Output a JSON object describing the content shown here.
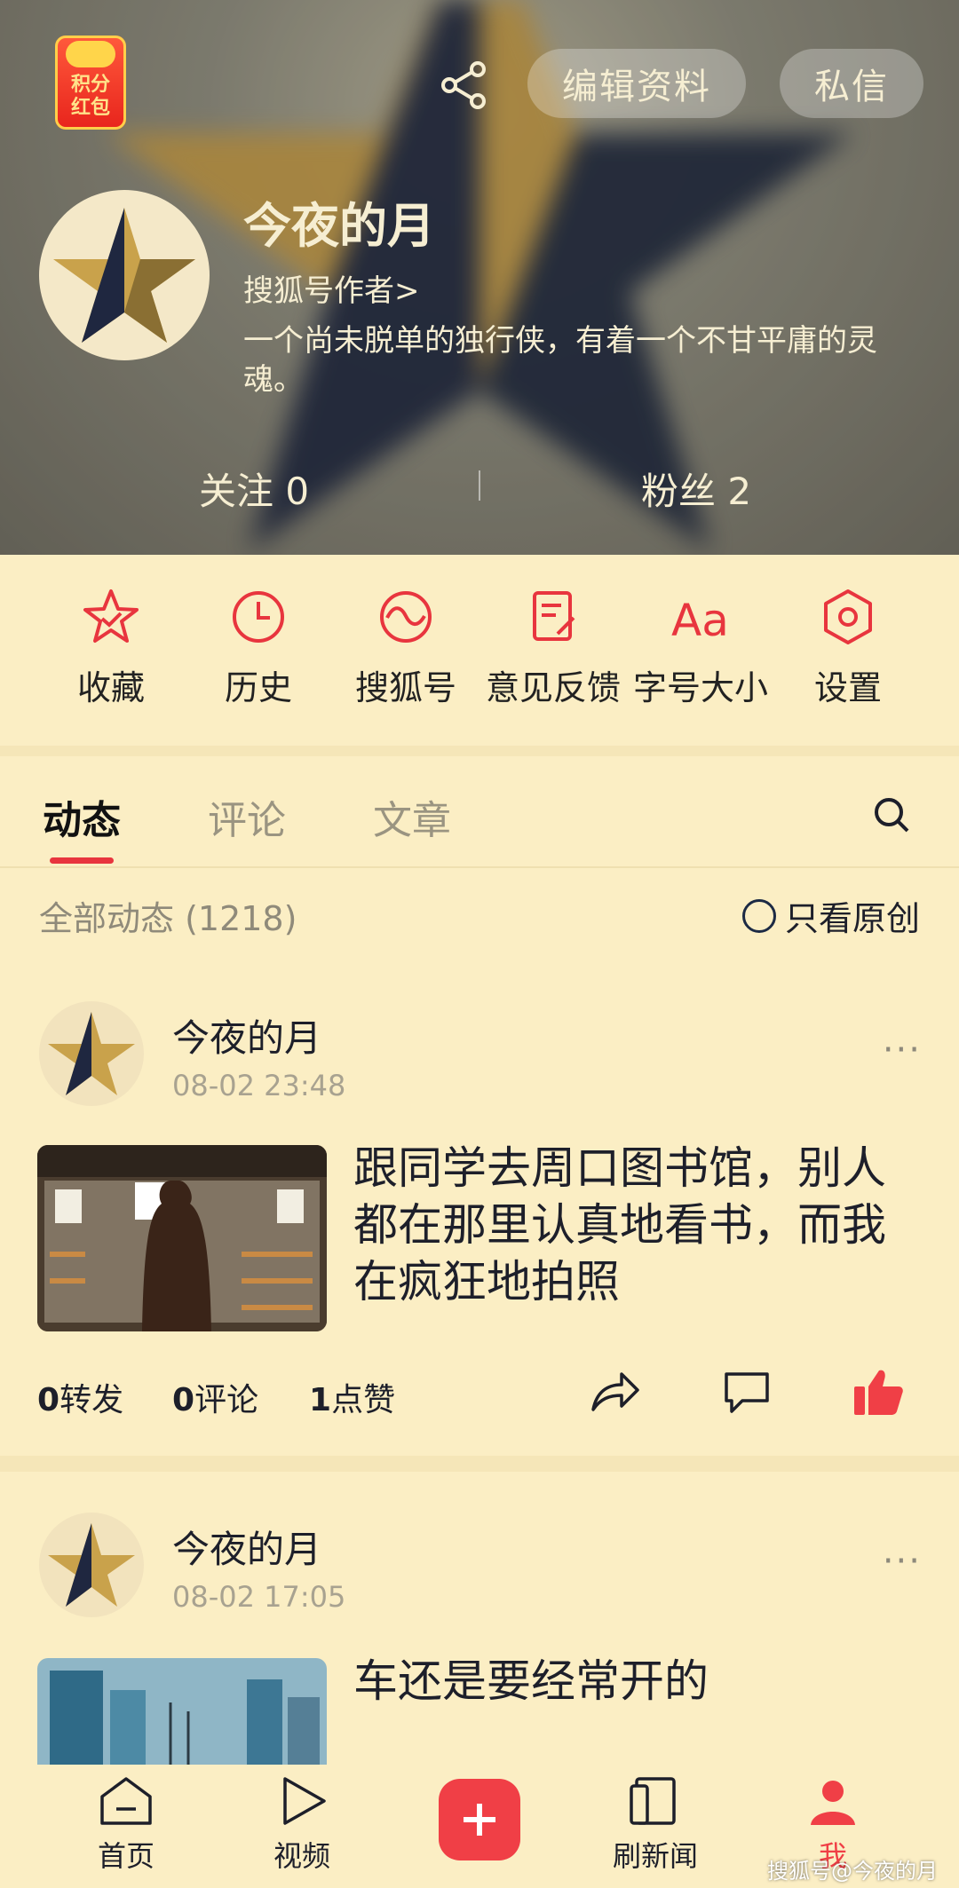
{
  "header": {
    "red_packet_label_1": "积分",
    "red_packet_label_2": "红包",
    "edit_profile_label": "编辑资料",
    "message_label": "私信",
    "share_icon": "share-icon",
    "username": "今夜的月",
    "author_link": "搜狐号作者>",
    "bio": "一个尚未脱单的独行侠，有着一个不甘平庸的灵魂。",
    "following": "关注 0",
    "followers": "粉丝 2"
  },
  "quick_menu": [
    {
      "icon": "star-icon",
      "label": "收藏"
    },
    {
      "icon": "clock-icon",
      "label": "历史"
    },
    {
      "icon": "sohu-icon",
      "label": "搜狐号"
    },
    {
      "icon": "feedback-icon",
      "label": "意见反馈"
    },
    {
      "icon": "font-size-icon",
      "label": "字号大小"
    },
    {
      "icon": "settings-icon",
      "label": "设置"
    }
  ],
  "tabs": [
    {
      "label": "动态",
      "active": true
    },
    {
      "label": "评论",
      "active": false
    },
    {
      "label": "文章",
      "active": false
    }
  ],
  "feed": {
    "filter_label": "全部动态 (1218)",
    "original_only_label": "只看原创",
    "posts": [
      {
        "author": "今夜的月",
        "time": "08-02 23:48",
        "title": "跟同学去周口图书馆，别人都在那里认真地看书，而我在疯狂地拍照",
        "reposts": "0",
        "reposts_label": "转发",
        "comments": "0",
        "comments_label": "评论",
        "likes": "1",
        "likes_label": "点赞"
      },
      {
        "author": "今夜的月",
        "time": "08-02 17:05",
        "title": "车还是要经常开的"
      }
    ],
    "more_label": "···"
  },
  "bottom_nav": [
    {
      "icon": "home-icon",
      "label": "首页"
    },
    {
      "icon": "video-icon",
      "label": "视频"
    },
    {
      "icon": "plus-icon",
      "label": "+"
    },
    {
      "icon": "news-icon",
      "label": "刷新闻"
    },
    {
      "icon": "me-icon",
      "label": "我"
    }
  ],
  "watermark": "搜狐号@今夜的月",
  "colors": {
    "accent": "#f03f46",
    "background": "#fbeec4",
    "star_gold": "#c9a24b",
    "star_navy": "#1f2740"
  }
}
